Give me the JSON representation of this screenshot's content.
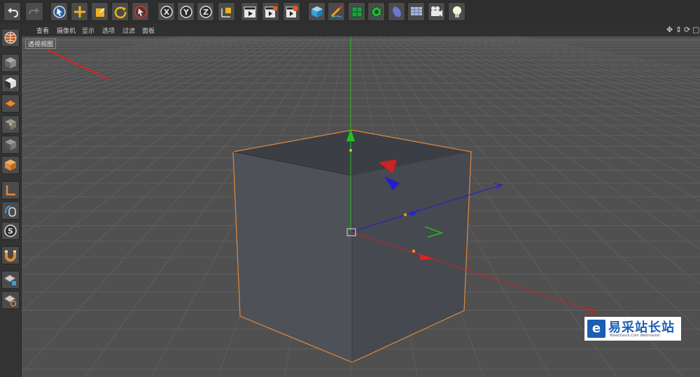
{
  "toolbar": {
    "buttons": [
      "undo",
      "select",
      "move",
      "scale",
      "rotate",
      "recent-tool",
      "x-axis",
      "y-axis",
      "z-axis",
      "coordinate-system",
      "render-view",
      "render-picture-viewer",
      "render-settings",
      "cube",
      "pen",
      "subdivision",
      "mograph",
      "deformer",
      "floor",
      "camera",
      "light"
    ],
    "axis_labels": {
      "x": "X",
      "y": "Y",
      "z": "Z"
    }
  },
  "menu": {
    "items": [
      "查看",
      "摄像机",
      "显示",
      "选项",
      "过滤",
      "面板"
    ]
  },
  "viewport": {
    "label": "透视视图",
    "background": "#505050",
    "grid_color": "#5f5f5f",
    "cube_top": "#3b3e44",
    "cube_left": "#4e5158",
    "cube_right": "#46494f",
    "selection_color": "#e08a3a",
    "axis_x_color": "#e02020",
    "axis_y_color": "#20c020",
    "axis_z_color": "#2020e0"
  },
  "watermark": {
    "logo": "e",
    "title": "易采站长站",
    "subtitle": "Www.Easck.Com Webmaster"
  }
}
